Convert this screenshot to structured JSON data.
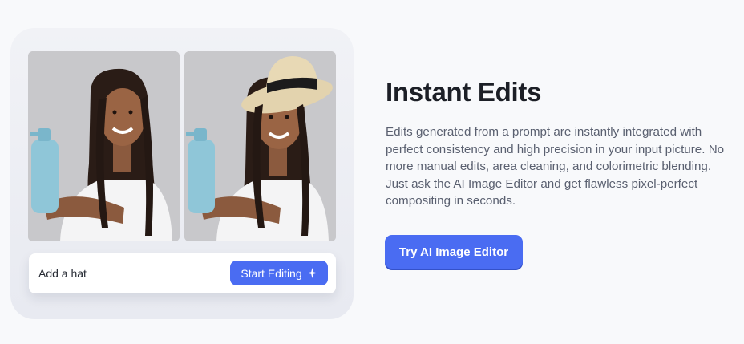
{
  "feature": {
    "title": "Instant Edits",
    "description": "Edits generated from a prompt are instantly integrated with perfect consistency and high precision in your input picture. No more manual edits, area cleaning, and colorimetric blending. Just ask the AI Image Editor and get flawless pixel-perfect compositing in seconds.",
    "cta_label": "Try AI Image Editor"
  },
  "demo": {
    "prompt_value": "Add a hat",
    "start_label": "Start Editing",
    "start_icon": "sparkle-icon",
    "images": [
      {
        "name": "before-photo",
        "description": "woman holding blue bottle"
      },
      {
        "name": "after-photo",
        "description": "woman holding blue bottle wearing straw hat"
      }
    ]
  },
  "colors": {
    "accent": "#4a6cf2",
    "page_bg": "#f8f9fb",
    "title": "#1c1f26",
    "body_text": "#5a6070"
  }
}
